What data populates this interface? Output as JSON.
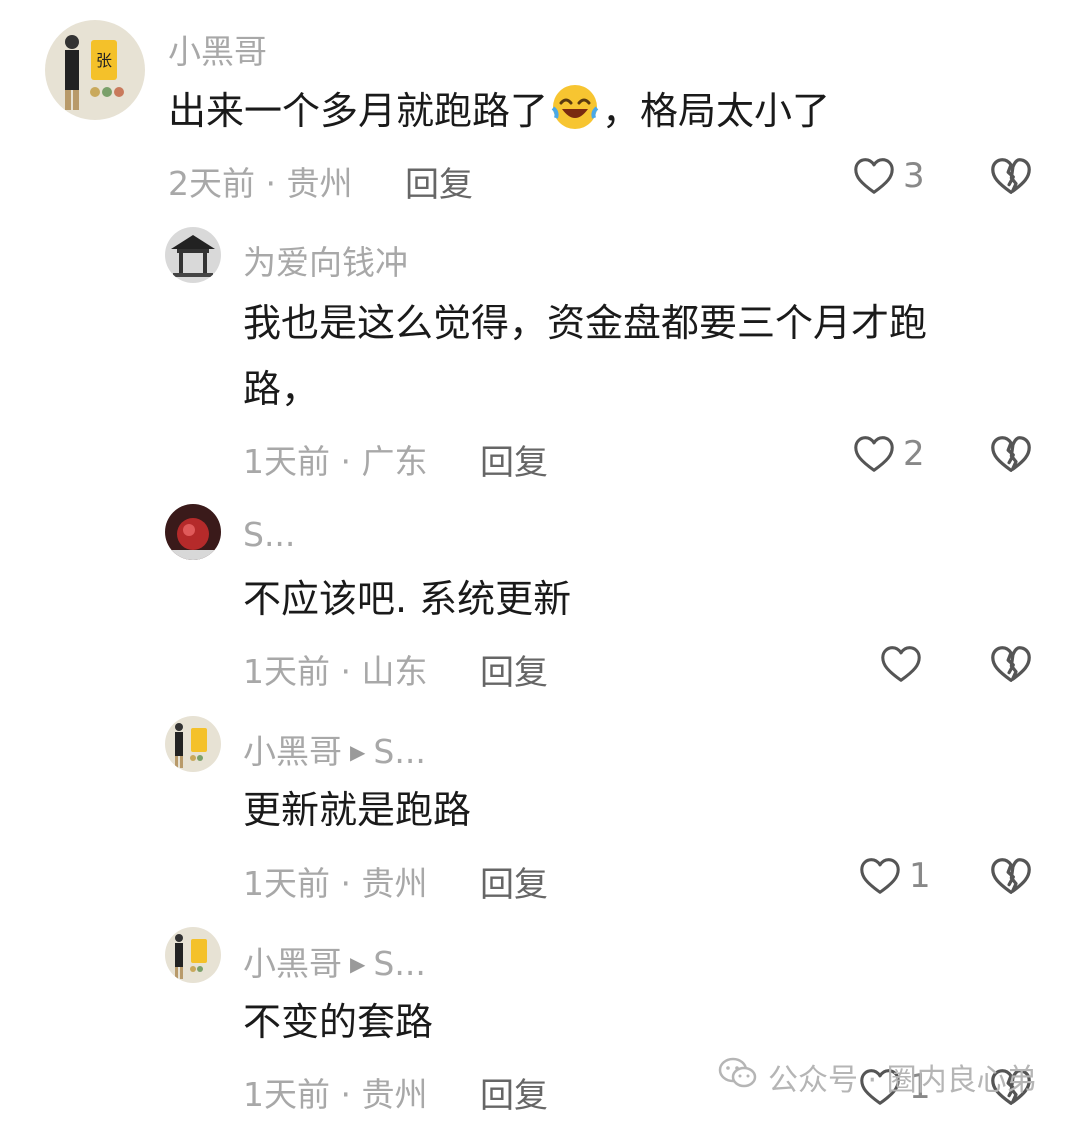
{
  "comments": [
    {
      "user": "小黑哥",
      "text_before": "出来一个多月就跑路了",
      "text_after": "，格局太小了",
      "meta": "2天前 · 贵州",
      "reply_label": "回复",
      "likes": "3"
    },
    {
      "user": "为爱向钱冲",
      "text": "我也是这么觉得，资金盘都要三个月才跑路，",
      "meta": "1天前 · 广东",
      "reply_label": "回复",
      "likes": "2"
    },
    {
      "user": "S...",
      "text": "不应该吧. 系统更新",
      "meta": "1天前 · 山东",
      "reply_label": "回复",
      "likes": ""
    },
    {
      "user": "小黑哥",
      "reply_to": "S...",
      "text": "更新就是跑路",
      "meta": "1天前 · 贵州",
      "reply_label": "回复",
      "likes": "1"
    },
    {
      "user": "小黑哥",
      "reply_to": "S...",
      "text": "不变的套路",
      "meta": "1天前 · 贵州",
      "reply_label": "回复",
      "likes": "1"
    }
  ],
  "watermark": {
    "text": "公众号 · 圈内良心弟"
  }
}
